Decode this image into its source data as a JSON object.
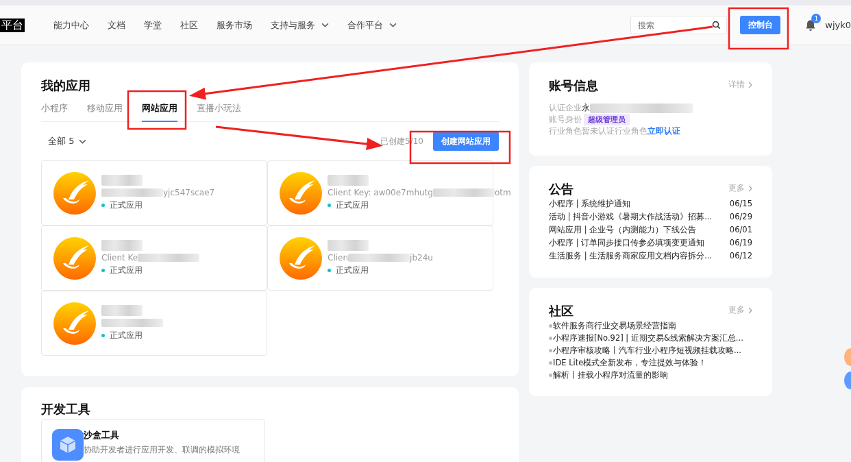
{
  "header": {
    "logo": "平台",
    "nav": [
      {
        "label": "能力中心",
        "dropdown": false
      },
      {
        "label": "文档",
        "dropdown": false
      },
      {
        "label": "学堂",
        "dropdown": false
      },
      {
        "label": "社区",
        "dropdown": false
      },
      {
        "label": "服务市场",
        "dropdown": false
      },
      {
        "label": "支持与服务",
        "dropdown": true
      },
      {
        "label": "合作平台",
        "dropdown": true
      }
    ],
    "search": {
      "placeholder": "搜索"
    },
    "console_button": "控制台",
    "notifications": "1",
    "user": "wjyk0"
  },
  "my_apps": {
    "title": "我的应用",
    "tabs": [
      {
        "label": "小程序",
        "selected": false
      },
      {
        "label": "移动应用",
        "selected": false
      },
      {
        "label": "网站应用",
        "selected": true
      },
      {
        "label": "直播小玩法",
        "selected": false
      }
    ],
    "filter": "全部 5",
    "created": "已创建5/10",
    "create_button": "创建网站应用",
    "apps": [
      {
        "key_end": "yjc547scae7",
        "status": "正式应用"
      },
      {
        "key_start": "Client Key: aw00e7mhutg",
        "key_end": "otm",
        "status": "正式应用"
      },
      {
        "key_start": "Client Ke",
        "status": "正式应用"
      },
      {
        "key_start": "Clien",
        "key_end": "jb24u",
        "status": "正式应用"
      },
      {
        "status": "正式应用"
      }
    ]
  },
  "dev_tools": {
    "title": "开发工具",
    "tools": [
      {
        "name": "沙盒工具",
        "description": "协助开发者进行应用开发、联调的模拟环境"
      }
    ]
  },
  "account": {
    "title": "账号信息",
    "link": "详情",
    "rows": [
      {
        "label": "认证企业",
        "value": "永",
        "kind": "blurred"
      },
      {
        "label": "账号身份",
        "value": "超级管理员",
        "kind": "tag"
      },
      {
        "label": "行业角色",
        "value": "暂未认证行业角色",
        "action": "立即认证",
        "kind": "link"
      }
    ]
  },
  "announcements": {
    "title": "公告",
    "link": "更多",
    "items": [
      {
        "text": "小程序 | 系统维护通知",
        "date": "06/15"
      },
      {
        "text": "活动 | 抖音小游戏《暑期大作战活动》招募...",
        "date": "06/29"
      },
      {
        "text": "网站应用 | 企业号（内测能力）下线公告",
        "date": "06/01"
      },
      {
        "text": "小程序 | 订单同步接口传参必填项变更通知",
        "date": "06/19"
      },
      {
        "text": "生活服务 | 生活服务商家应用文档内容拆分...",
        "date": "06/12"
      }
    ]
  },
  "community": {
    "title": "社区",
    "link": "更多",
    "items": [
      "软件服务商行业交易场景经营指南",
      "小程序速报[No.92] | 近期交易&线索解决方案汇总...",
      "小程序审核攻略丨汽车行业小程序短视频挂载攻略...",
      "IDE Lite模式全新发布，专注提效与体验！",
      "解析丨挂载小程序对流量的影响"
    ]
  }
}
